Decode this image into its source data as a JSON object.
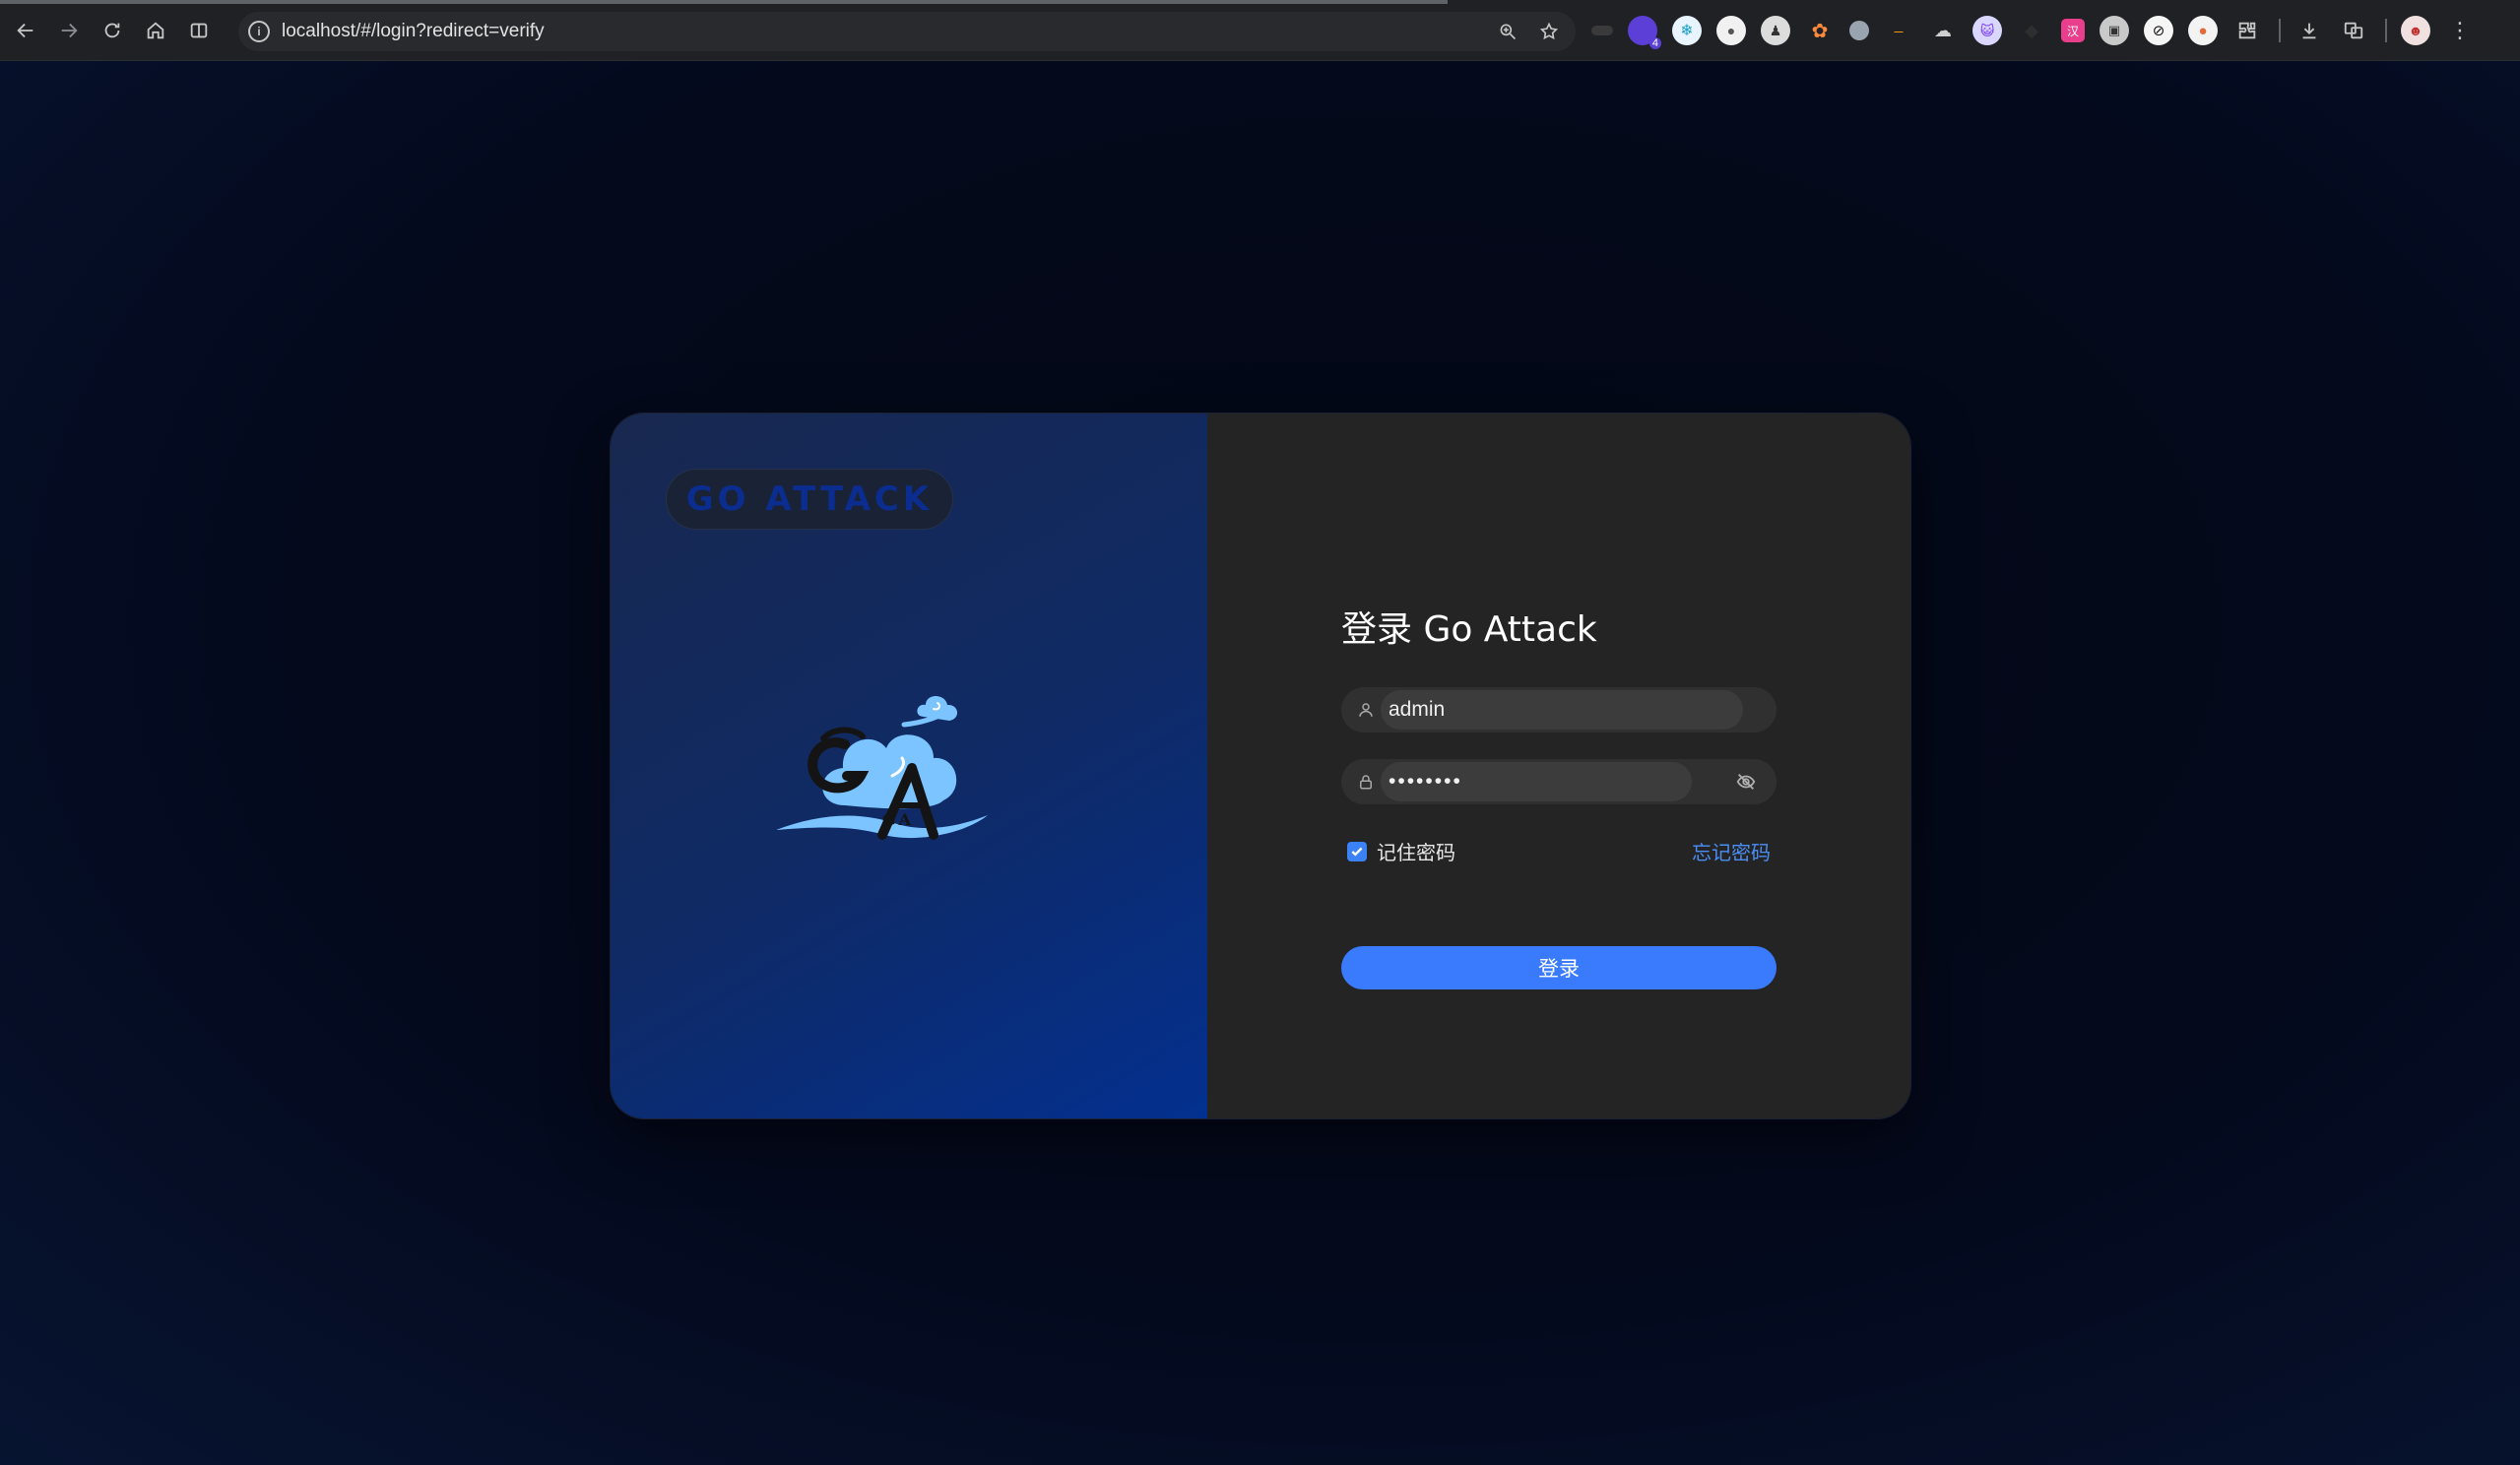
{
  "browser": {
    "url": "localhost/#/login?redirect=verify",
    "site_info_icon": "info-icon",
    "nav": [
      "back-icon",
      "forward-icon",
      "reload-icon",
      "home-icon",
      "split-view-icon"
    ],
    "omnibox_icons": [
      "zoom-icon",
      "star-icon"
    ],
    "extensions_count": 16,
    "extension_badge": "4"
  },
  "brand": {
    "pill_text": "GO ATTACK",
    "logo_letters": "GA"
  },
  "login": {
    "title": "登录 Go Attack",
    "username_value": "admin",
    "password_value": "••••••••",
    "remember_label": "记住密码",
    "remember_checked": true,
    "forgot_label": "忘记密码",
    "submit_label": "登录"
  },
  "colors": {
    "accent": "#3a7bfd",
    "link": "#4a8ef5",
    "brand_text": "#0a2d8f",
    "panel": "#242424"
  }
}
